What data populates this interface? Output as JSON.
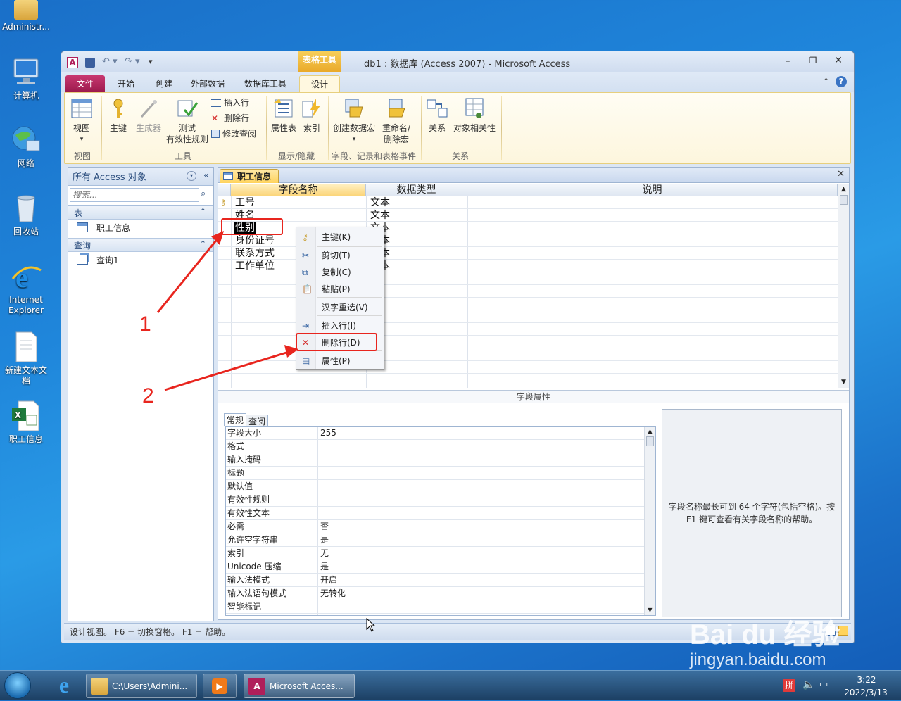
{
  "desktop": {
    "icons": [
      {
        "label": "Administr..."
      },
      {
        "label": "计算机"
      },
      {
        "label": "网络"
      },
      {
        "label": "回收站"
      },
      {
        "label": "Internet Explorer"
      },
      {
        "label": "新建文本文档"
      },
      {
        "label": "职工信息"
      }
    ]
  },
  "window": {
    "title": "db1 : 数据库 (Access 2007)  -  Microsoft Access",
    "context_tab_group": "表格工具",
    "tabs": [
      "文件",
      "开始",
      "创建",
      "外部数据",
      "数据库工具",
      "设计"
    ],
    "ribbon": {
      "view_group": {
        "view": "视图",
        "group": "视图"
      },
      "tools_group": {
        "primary_key": "主键",
        "builder": "生成器",
        "test": "测试",
        "test2": "有效性规则",
        "insert_rows": "插入行",
        "delete_rows": "删除行",
        "modify_lookups": "修改查阅",
        "group": "工具"
      },
      "show_group": {
        "property_sheet": "属性表",
        "indexes": "索引",
        "group": "显示/隐藏"
      },
      "events_group": {
        "create_macro": "创建数据宏",
        "rename_macro": "重命名/",
        "rename_macro2": "删除宏",
        "group": "字段、记录和表格事件"
      },
      "relationships_group": {
        "relationships": "关系",
        "dependencies": "对象相关性",
        "group": "关系"
      }
    }
  },
  "nav": {
    "header": "所有 Access 对象",
    "search_placeholder": "搜索...",
    "sections": [
      {
        "label": "表",
        "items": [
          "职工信息"
        ]
      },
      {
        "label": "查询",
        "items": [
          "查询1"
        ]
      }
    ]
  },
  "document": {
    "tab": "职工信息",
    "columns": [
      "字段名称",
      "数据类型",
      "说明"
    ],
    "rows": [
      {
        "name": "工号",
        "type": "文本"
      },
      {
        "name": "姓名",
        "type": "文本"
      },
      {
        "name": "性别",
        "type": "文本"
      },
      {
        "name": "身份证号",
        "type": "文本"
      },
      {
        "name": "联系方式",
        "type": "文本"
      },
      {
        "name": "工作单位",
        "type": "文本"
      }
    ],
    "field_properties_label": "字段属性",
    "prop_tabs": [
      "常规",
      "查阅"
    ],
    "properties": [
      {
        "name": "字段大小",
        "value": "255"
      },
      {
        "name": "格式",
        "value": ""
      },
      {
        "name": "输入掩码",
        "value": ""
      },
      {
        "name": "标题",
        "value": ""
      },
      {
        "name": "默认值",
        "value": ""
      },
      {
        "name": "有效性规则",
        "value": ""
      },
      {
        "name": "有效性文本",
        "value": ""
      },
      {
        "name": "必需",
        "value": "否"
      },
      {
        "name": "允许空字符串",
        "value": "是"
      },
      {
        "name": "索引",
        "value": "无"
      },
      {
        "name": "Unicode 压缩",
        "value": "是"
      },
      {
        "name": "输入法模式",
        "value": "开启"
      },
      {
        "name": "输入法语句模式",
        "value": "无转化"
      },
      {
        "name": "智能标记",
        "value": ""
      }
    ],
    "help_text": "字段名称最长可到 64 个字符(包括空格)。按 F1 键可查看有关字段名称的帮助。"
  },
  "context_menu": {
    "items": [
      "主键(K)",
      "剪切(T)",
      "复制(C)",
      "粘贴(P)",
      "汉字重选(V)",
      "插入行(I)",
      "删除行(D)",
      "属性(P)"
    ]
  },
  "status_bar": "设计视图。  F6 = 切换窗格。  F1 = 帮助。",
  "annotations": {
    "one": "1",
    "two": "2"
  },
  "taskbar": {
    "explorer_label": "C:\\Users\\Admini...",
    "access_label": "Microsoft Acces...",
    "ime": "拼",
    "time": "3:22",
    "date": "2022/3/13"
  },
  "watermark": {
    "brand": "Bai du 经验",
    "url": "jingyan.baidu.com"
  },
  "colors": {
    "accent_red": "#e8251e",
    "file_tab": "#b01f5a",
    "selected_tab": "#fff5d6"
  }
}
